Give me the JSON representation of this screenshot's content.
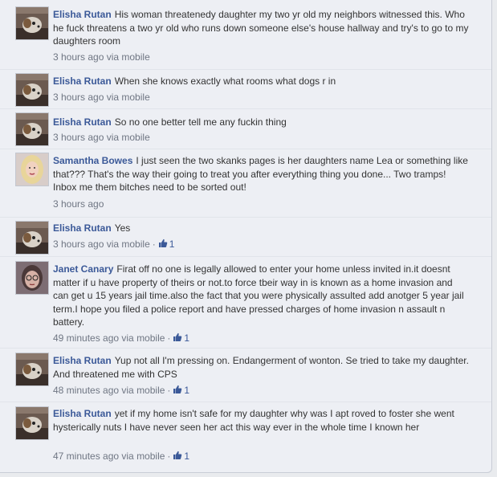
{
  "comments": [
    {
      "author": "Elisha Rutan",
      "avatar": "dog-photo-avatar",
      "text": "His woman threatenedy daughter my two yr old my neighbors witnessed this. Who he fuck threatens a two yr old who runs down someone else's house hallway and try's to go to my daughters room",
      "time": "3 hours ago via mobile",
      "likes": ""
    },
    {
      "author": "Elisha Rutan",
      "avatar": "dog-photo-avatar",
      "text": "When she knows exactly what rooms what dogs r in",
      "time": "3 hours ago via mobile",
      "likes": ""
    },
    {
      "author": "Elisha Rutan",
      "avatar": "dog-photo-avatar",
      "text": "So no one better tell me any fuckin thing",
      "time": "3 hours ago via mobile",
      "likes": ""
    },
    {
      "author": "Samantha Bowes",
      "avatar": "blonde-woman-avatar",
      "text": "I just seen the two skanks pages is her daughters name Lea or something like that??? That's the way their going to treat you after everything thing you done... Two tramps! Inbox me them bitches need to be sorted out!",
      "time": "3 hours ago",
      "likes": ""
    },
    {
      "author": "Elisha Rutan",
      "avatar": "dog-photo-avatar",
      "text": "Yes",
      "time": "3 hours ago via mobile",
      "likes": "1"
    },
    {
      "author": "Janet Canary",
      "avatar": "woman-glasses-avatar",
      "text": "Firat off no one is legally allowed to enter your home unless invited in.it doesnt matter if u have property of theirs or not.to force tbeir way in is known as a home invasion and can get u 15 years jail time.also the fact that you were physically assulted add anotger 5 year jail term.I hope you filed a police report and have pressed charges of home invasion n assault n battery.",
      "time": "49 minutes ago via mobile",
      "likes": "1"
    },
    {
      "author": "Elisha Rutan",
      "avatar": "dog-photo-avatar",
      "text": "Yup not all I'm pressing on. Endangerment of wonton. Se tried to take my daughter. And threatened me with CPS",
      "time": "48 minutes ago via mobile",
      "likes": "1"
    },
    {
      "author": "Elisha Rutan",
      "avatar": "dog-photo-avatar",
      "text": "yet if my home isn't safe for my daughter why was I apt roved to foster she went hysterically nuts I have never seen her act this way ever in the whole time I known her",
      "time": "47 minutes ago via mobile",
      "likes": "1"
    }
  ],
  "colors": {
    "link": "#3b5998",
    "meta": "#6f7683",
    "background": "#edeff4"
  }
}
